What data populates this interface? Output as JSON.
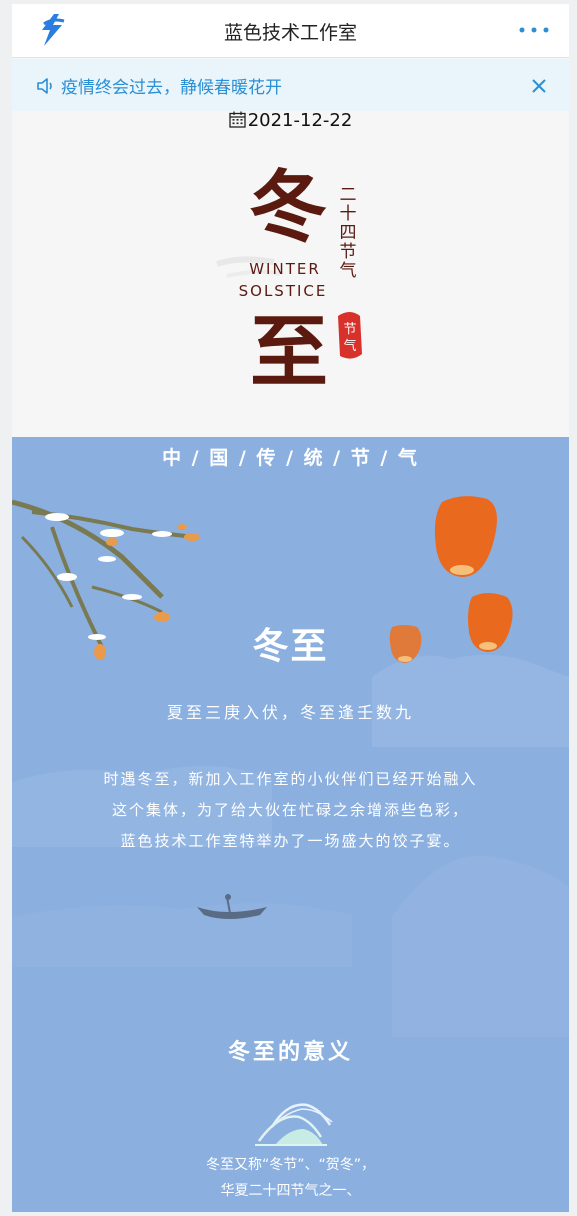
{
  "navbar": {
    "title": "蓝色技术工作室",
    "logo_icon": "lightning-logo-icon",
    "more_icon": "more-dots-icon"
  },
  "notice": {
    "text": "疫情终会过去，静候春暖花开",
    "speaker_icon": "speaker-icon",
    "close_icon": "close-icon"
  },
  "post": {
    "date": "2021-12-22",
    "calendar_icon": "calendar-icon"
  },
  "hero": {
    "big_char_1": "冬",
    "big_char_2": "至",
    "vertical_text": [
      "二",
      "十",
      "四",
      "节",
      "气"
    ],
    "english_line_1": "WINTER",
    "english_line_2": "SOLSTICE",
    "seal_text_1": "节",
    "seal_text_2": "气"
  },
  "article": {
    "heading": "中 / 国 / 传 / 统 / 节 / 气",
    "title": "冬至",
    "poem": "夏至三庚入伏，冬至逢壬数九",
    "paragraph": [
      "时遇冬至，新加入工作室的小伙伴们已经开始融入",
      "这个集体，为了给大伙在忙碌之余增添些色彩，",
      "蓝色技术工作室特举办了一场盛大的饺子宴。"
    ],
    "meaning_title": "冬至的意义",
    "meaning_lines": [
      "冬至又称“冬节”、“贺冬”，",
      "华夏二十四节气之一、"
    ]
  },
  "colors": {
    "accent": "#2a8fd4",
    "notice_bg": "#e9f4fb",
    "section_bg": "#8bb0e0",
    "calligraphy": "#5a1a10",
    "seal_red": "#d8302a",
    "lantern": "#e9691f"
  }
}
